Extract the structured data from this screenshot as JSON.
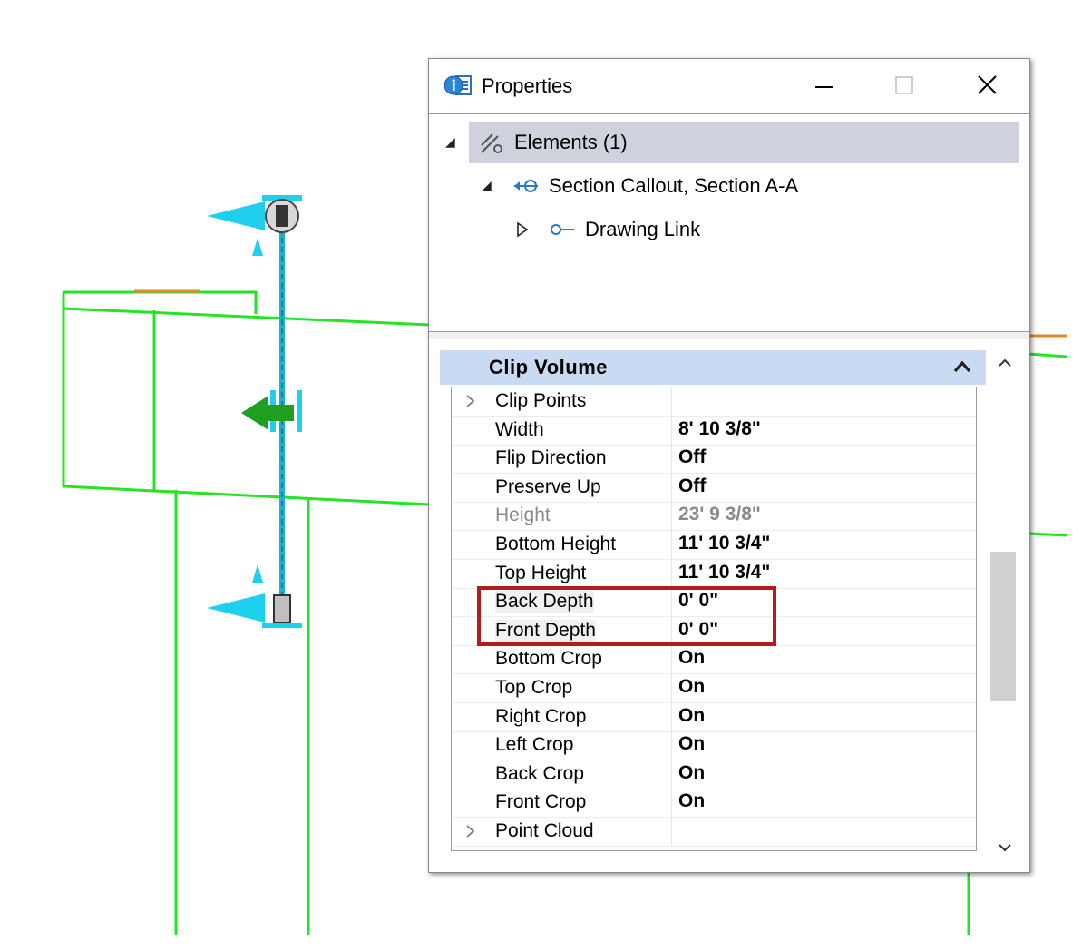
{
  "window": {
    "title": "Properties",
    "icon": "properties-info-icon",
    "controls": [
      "minimize-icon",
      "maximize-icon",
      "close-icon"
    ]
  },
  "tree": {
    "items": [
      {
        "label": "Elements (1)",
        "icon": "elements-icon",
        "expanded": true,
        "selected": true
      },
      {
        "label": "Section Callout, Section A-A",
        "icon": "section-callout-icon",
        "expanded": true
      },
      {
        "label": "Drawing Link",
        "icon": "drawing-link-icon",
        "expanded": false
      }
    ]
  },
  "group": {
    "title": "Clip Volume",
    "collapse_icon": "chevron-up-icon"
  },
  "properties": [
    {
      "name": "Clip Points",
      "value": "",
      "expandable": true
    },
    {
      "name": "Width",
      "value": "8' 10 3/8\""
    },
    {
      "name": "Flip Direction",
      "value": "Off"
    },
    {
      "name": "Preserve Up",
      "value": "Off"
    },
    {
      "name": "Height",
      "value": "23' 9 3/8\"",
      "readonly": true
    },
    {
      "name": "Bottom Height",
      "value": "11' 10 3/4\""
    },
    {
      "name": "Top Height",
      "value": "11' 10 3/4\""
    },
    {
      "name": "Back Depth",
      "value": "0' 0\"",
      "highlighted": true
    },
    {
      "name": "Front Depth",
      "value": "0' 0\"",
      "highlighted": true
    },
    {
      "name": "Bottom Crop",
      "value": "On"
    },
    {
      "name": "Top Crop",
      "value": "On"
    },
    {
      "name": "Right Crop",
      "value": "On"
    },
    {
      "name": "Left Crop",
      "value": "On"
    },
    {
      "name": "Back Crop",
      "value": "On"
    },
    {
      "name": "Front Crop",
      "value": "On"
    },
    {
      "name": "Point Cloud",
      "value": "",
      "expandable": true
    }
  ],
  "colors": {
    "drawing_lines": "#22e622",
    "section_marker": "#1fd0ee",
    "arrow": "#1f9e1f",
    "highlight_box": "#b21c1c",
    "group_header": "#c8dbf2",
    "selected_row": "#cfd1dc"
  }
}
